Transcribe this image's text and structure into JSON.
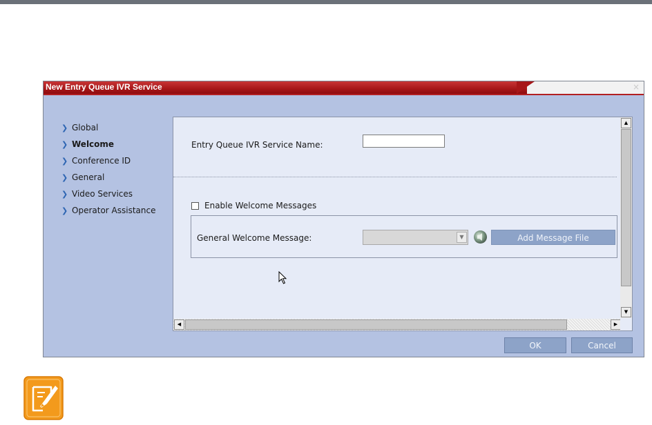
{
  "window": {
    "title": "New Entry Queue IVR Service",
    "close_glyph": "×"
  },
  "sidebar": {
    "items": [
      {
        "label": "Global",
        "active": false
      },
      {
        "label": "Welcome",
        "active": true
      },
      {
        "label": "Conference ID",
        "active": false
      },
      {
        "label": "General",
        "active": false
      },
      {
        "label": "Video Services",
        "active": false
      },
      {
        "label": "Operator Assistance",
        "active": false
      }
    ]
  },
  "main": {
    "service_name_label": "Entry Queue IVR Service Name:",
    "service_name_value": "",
    "enable_welcome_label": "Enable Welcome Messages",
    "enable_welcome_checked": false,
    "general_welcome_label": "General Welcome Message:",
    "general_welcome_value": "",
    "add_message_file_label": "Add Message File"
  },
  "footer": {
    "ok_label": "OK",
    "cancel_label": "Cancel"
  },
  "icons": {
    "nav_arrow": "chevron-right-icon",
    "speaker": "speaker-icon",
    "cursor": "mouse-pointer-icon",
    "note": "note-icon"
  },
  "colors": {
    "title_bar": "#a71618",
    "dialog_bg": "#b4c2e2",
    "panel_bg": "#e6ebf7",
    "button_bg": "#8da3c8",
    "note_icon": "#f39a1c"
  }
}
